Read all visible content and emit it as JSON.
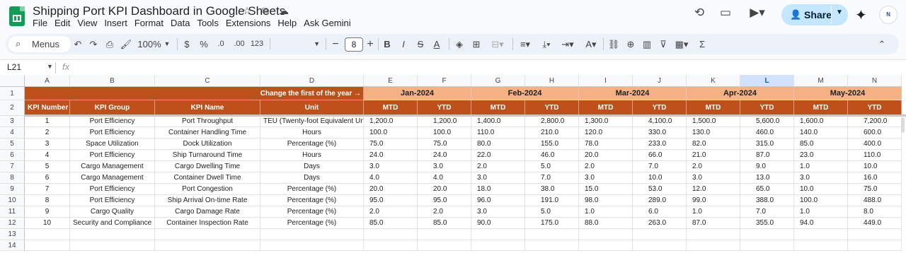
{
  "doc": {
    "title": "Shipping Port KPI Dashboard in Google Sheets",
    "menu": [
      "File",
      "Edit",
      "View",
      "Insert",
      "Format",
      "Data",
      "Tools",
      "Extensions",
      "Help",
      "Ask Gemini"
    ],
    "share_label": "Share"
  },
  "toolbar": {
    "menus_label": "Menus",
    "zoom": "100%",
    "currency": "$",
    "percent": "%",
    "dec_decrease": ".0",
    "dec_increase": ".00",
    "number_format": "123",
    "font_size": "8"
  },
  "formula_bar": {
    "cell_ref": "L21",
    "fx": "fx"
  },
  "columns": [
    "A",
    "B",
    "C",
    "D",
    "E",
    "F",
    "G",
    "H",
    "I",
    "J",
    "K",
    "L",
    "M",
    "N"
  ],
  "selected_column": "L",
  "rows": [
    "1",
    "2",
    "3",
    "4",
    "5",
    "6",
    "7",
    "8",
    "9",
    "10",
    "11",
    "12",
    "13",
    "14"
  ],
  "sheet": {
    "change_note": "Change the first of the year →",
    "months": [
      "Jan-2024",
      "Feb-2024",
      "Mar-2024",
      "Apr-2024",
      "May-2024"
    ],
    "headers": [
      "KPI Number",
      "KPI Group",
      "KPI Name",
      "Unit"
    ],
    "mtd": "MTD",
    "ytd": "YTD",
    "data": [
      [
        "1",
        "Port Efficiency",
        "Port Throughput",
        "TEU (Twenty-foot Equivalent Units)",
        "1,200.0",
        "1,200.0",
        "1,400.0",
        "2,800.0",
        "1,300.0",
        "4,100.0",
        "1,500.0",
        "5,600.0",
        "1,600.0",
        "7,200.0"
      ],
      [
        "2",
        "Port Efficiency",
        "Container Handling Time",
        "Hours",
        "100.0",
        "100.0",
        "110.0",
        "210.0",
        "120.0",
        "330.0",
        "130.0",
        "460.0",
        "140.0",
        "600.0"
      ],
      [
        "3",
        "Space Utilization",
        "Dock Utilization",
        "Percentage (%)",
        "75.0",
        "75.0",
        "80.0",
        "155.0",
        "78.0",
        "233.0",
        "82.0",
        "315.0",
        "85.0",
        "400.0"
      ],
      [
        "4",
        "Port Efficiency",
        "Ship Turnaround Time",
        "Hours",
        "24.0",
        "24.0",
        "22.0",
        "46.0",
        "20.0",
        "66.0",
        "21.0",
        "87.0",
        "23.0",
        "110.0"
      ],
      [
        "5",
        "Cargo Management",
        "Cargo Dwelling Time",
        "Days",
        "3.0",
        "3.0",
        "2.0",
        "5.0",
        "2.0",
        "7.0",
        "2.0",
        "9.0",
        "1.0",
        "10.0"
      ],
      [
        "6",
        "Cargo Management",
        "Container Dwell Time",
        "Days",
        "4.0",
        "4.0",
        "3.0",
        "7.0",
        "3.0",
        "10.0",
        "3.0",
        "13.0",
        "3.0",
        "16.0"
      ],
      [
        "7",
        "Port Efficiency",
        "Port Congestion",
        "Percentage (%)",
        "20.0",
        "20.0",
        "18.0",
        "38.0",
        "15.0",
        "53.0",
        "12.0",
        "65.0",
        "10.0",
        "75.0"
      ],
      [
        "8",
        "Port Efficiency",
        "Ship Arrival On-time Rate",
        "Percentage (%)",
        "95.0",
        "95.0",
        "96.0",
        "191.0",
        "98.0",
        "289.0",
        "99.0",
        "388.0",
        "100.0",
        "488.0"
      ],
      [
        "9",
        "Cargo Quality",
        "Cargo Damage Rate",
        "Percentage (%)",
        "2.0",
        "2.0",
        "3.0",
        "5.0",
        "1.0",
        "6.0",
        "1.0",
        "7.0",
        "1.0",
        "8.0"
      ],
      [
        "10",
        "Security and Compliance",
        "Container Inspection Rate",
        "Percentage (%)",
        "85.0",
        "85.0",
        "90.0",
        "175.0",
        "88.0",
        "263.0",
        "87.0",
        "355.0",
        "94.0",
        "449.0"
      ]
    ]
  },
  "colors": {
    "header_dark": "#c0501b",
    "header_light": "#f4b183",
    "share_bg": "#c2e7ff",
    "sheets_green": "#0f9d58"
  }
}
